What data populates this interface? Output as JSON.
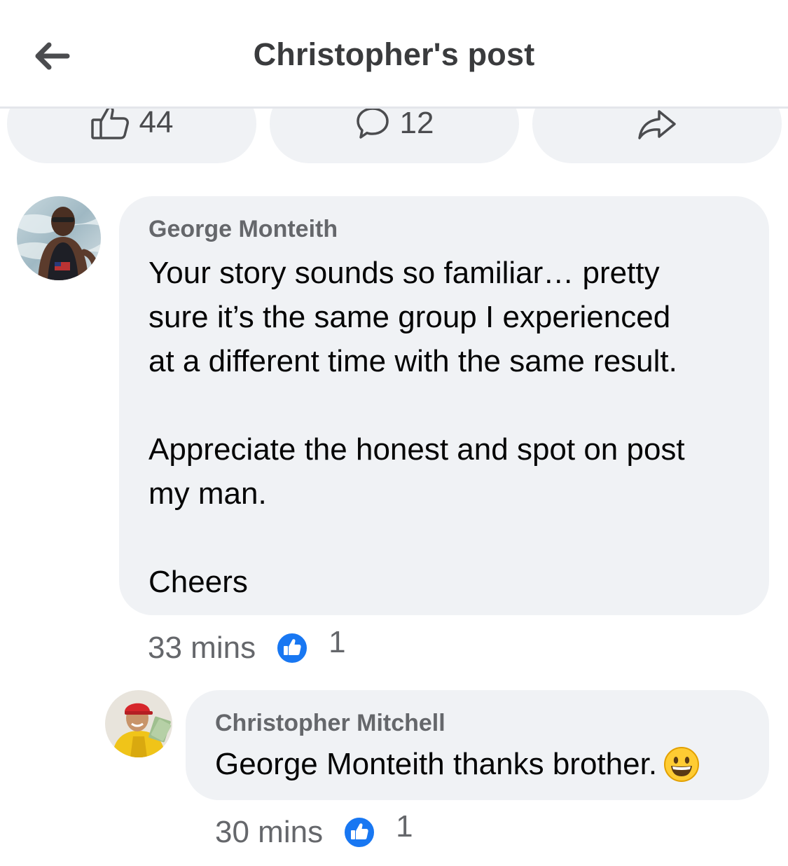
{
  "header": {
    "title": "Christopher's post",
    "back_icon": "arrow-left-icon"
  },
  "actions": {
    "like_count": "44",
    "comment_count": "12",
    "like_icon": "thumbs-up-outline-icon",
    "comment_icon": "speech-bubble-icon",
    "share_icon": "share-arrow-icon"
  },
  "comments": [
    {
      "author": "George Monteith",
      "text": "Your story sounds so familiar… pretty\nsure it’s the same group I experienced\nat a different time with the same result.\n\nAppreciate the honest and spot on post\nmy man.\n\nCheers",
      "time": "33 mins",
      "reaction_count": "1",
      "reaction_icon": "like-reaction-icon"
    },
    {
      "author": "Christopher Mitchell",
      "text": "George Monteith thanks brother.",
      "emoji": "grinning-face-emoji",
      "time": "30 mins",
      "reaction_count": "1",
      "reaction_icon": "like-reaction-icon"
    }
  ],
  "colors": {
    "bubble": "#f0f2f5",
    "secondary_text": "#65676b",
    "like_blue": "#1877f2",
    "divider": "#e4e6eb"
  }
}
